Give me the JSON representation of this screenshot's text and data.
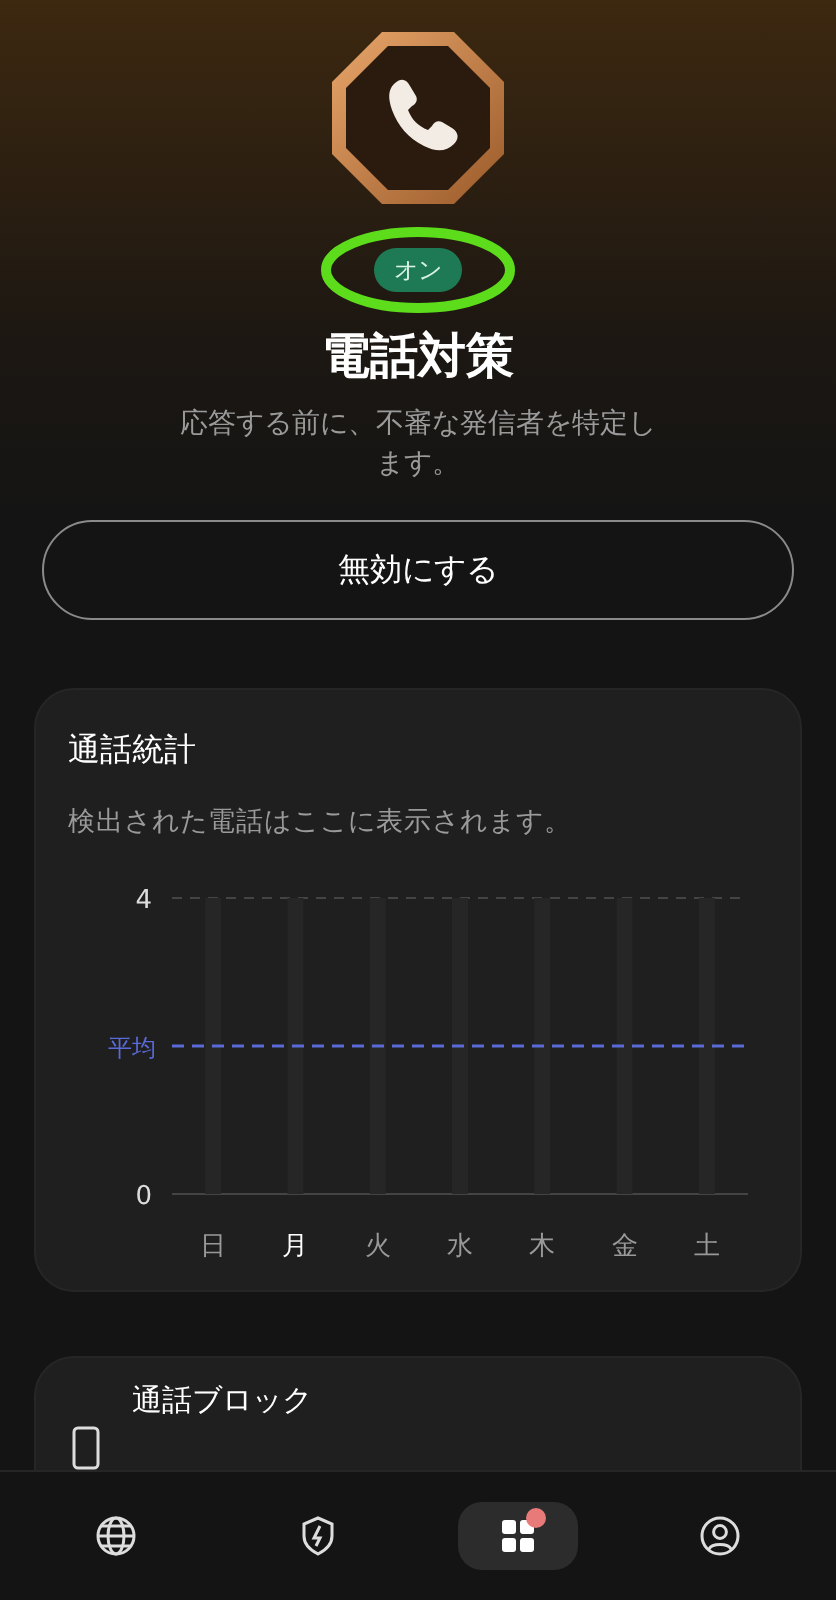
{
  "header": {
    "status_badge": "オン",
    "badge_on": true,
    "title": "電話対策",
    "description": "応答する前に、不審な発信者を特定します。"
  },
  "disable_button": "無効にする",
  "stats_card": {
    "title": "通話統計",
    "subtitle": "検出された電話はここに表示されます。",
    "chart": {
      "axis_top_label": "4",
      "average_label": "平均",
      "axis_bottom_label": "0",
      "days": [
        {
          "label": "日",
          "selected": false
        },
        {
          "label": "月",
          "selected": true
        },
        {
          "label": "火",
          "selected": false
        },
        {
          "label": "水",
          "selected": false
        },
        {
          "label": "木",
          "selected": false
        },
        {
          "label": "金",
          "selected": false
        },
        {
          "label": "土",
          "selected": false
        }
      ]
    }
  },
  "feature_rows": [
    {
      "title": "通話ブロック"
    }
  ],
  "bottom_nav": [
    {
      "selected": false
    },
    {
      "selected": false
    },
    {
      "selected": true,
      "badge": true
    },
    {
      "selected": false
    }
  ]
}
